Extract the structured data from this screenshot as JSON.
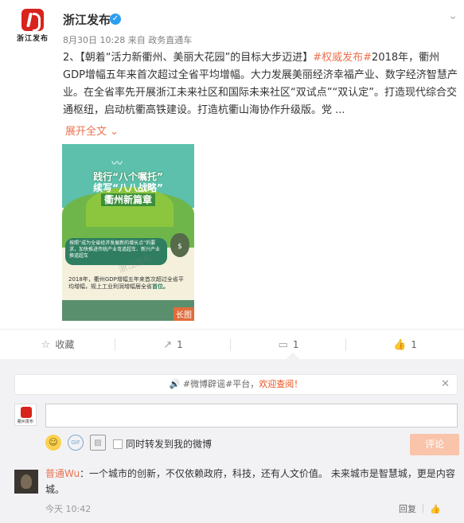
{
  "post": {
    "avatar_text": "浙江发布",
    "username": "浙江发布",
    "verified_glyph": "✓",
    "timestamp": "8月30日 10:28",
    "source_prefix": "来自",
    "source": "政务直通车",
    "content_prefix": "2、【朝着“活力新衢州、美丽大花园”的目标大步迈进】",
    "hashtag": "#权威发布#",
    "content_body": "2018年，衢州GDP增幅五年来首次超过全省平均增幅。大力发展美丽经济幸福产业、数字经济智慧产业。在全省率先开展浙江未来社区和国际未来社区“双试点”“双认定”。打造现代综合交通枢纽，启动杭衢高铁建设。打造杭衢山海协作升级版。党 ...",
    "expand_label": "展开全文",
    "expand_glyph": "⌄",
    "image": {
      "banner_line1": "践行“八个嘱托”",
      "banner_line2": "续写“八八战略”",
      "banner_line3": "衢州新篇章",
      "box_text": "按照“成为全省经济发展新的增长点”的要求，加快推进传统产业弯道超车、新兴产业换道超车",
      "para_text": "2018年，衢州GDP增幅五年来首次超过全省平均增幅，规上工业利润增幅居全省",
      "para_highlight": "首位。",
      "watermark": "浙江发布",
      "long_tag": "长图"
    }
  },
  "actions": {
    "favorite_label": "收藏",
    "forward_count": "1",
    "comment_count": "1",
    "like_count": "1"
  },
  "comments": {
    "notice_text": "#微博辟谣#平台，",
    "notice_highlight": "欢迎查阅！",
    "close_glyph": "✕",
    "commenter_avatar_text": "衢州发布",
    "input_value": "",
    "repost_label": "同时转发到我的微博",
    "submit_label": "评论",
    "reply": {
      "user": "普通Wu",
      "text": "：一个城市的创新，不仅依赖政府，科技，还有人文价值。  未来城市是智慧城，更是内容城。",
      "time": "今天 10:42",
      "reply_label": "回复",
      "like_glyph": "👍"
    }
  }
}
